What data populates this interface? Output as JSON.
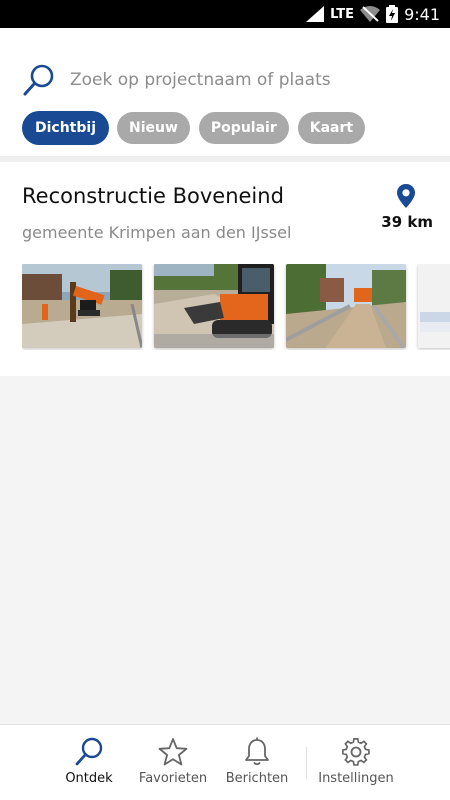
{
  "status_bar": {
    "network": "LTE",
    "time": "9:41"
  },
  "search": {
    "placeholder": "Zoek op projectnaam of plaats"
  },
  "filters": [
    {
      "label": "Dichtbij",
      "active": true
    },
    {
      "label": "Nieuw",
      "active": false
    },
    {
      "label": "Populair",
      "active": false
    },
    {
      "label": "Kaart",
      "active": false
    }
  ],
  "project": {
    "title": "Reconstructie Boveneind",
    "municipality": "gemeente Krimpen aan den IJssel",
    "distance": "39 km"
  },
  "nav": [
    {
      "label": "Ontdek",
      "icon": "search-icon",
      "active": true
    },
    {
      "label": "Favorieten",
      "icon": "star-icon",
      "active": false
    },
    {
      "label": "Berichten",
      "icon": "bell-icon",
      "active": false
    },
    {
      "label": "Instellingen",
      "icon": "gear-icon",
      "active": false
    }
  ],
  "colors": {
    "accent": "#1a4a94",
    "chip_inactive": "#a9a9a9",
    "background": "#f4f4f4"
  }
}
